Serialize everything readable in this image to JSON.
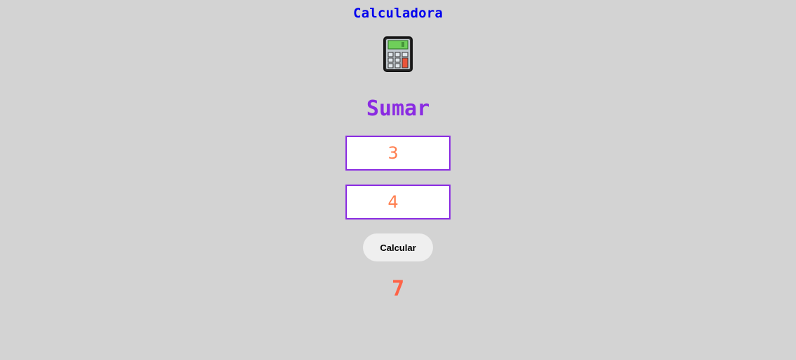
{
  "header": {
    "title": "Calculadora",
    "icon": "calculator-icon"
  },
  "operation": {
    "label": "Sumar"
  },
  "inputs": {
    "first_value": "3",
    "second_value": "4"
  },
  "action": {
    "button_label": "Calcular"
  },
  "result": {
    "value": "7"
  },
  "colors": {
    "background": "#d3d3d3",
    "title": "#0000ee",
    "operation": "#8a2be2",
    "input_border": "#8a2be2",
    "input_text": "#ff7f50",
    "result": "#ff6347",
    "button_bg": "#efefef"
  }
}
